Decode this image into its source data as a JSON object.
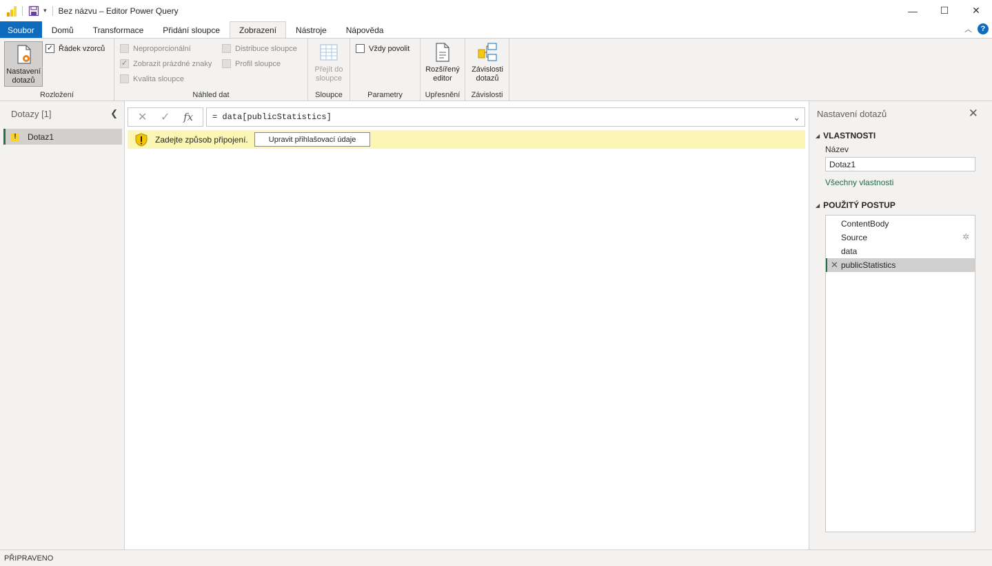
{
  "titlebar": {
    "title": "Bez názvu – Editor Power Query",
    "minimize": "—",
    "maximize": "☐",
    "close": "✕"
  },
  "tabs": [
    {
      "label": "Soubor"
    },
    {
      "label": "Domů"
    },
    {
      "label": "Transformace"
    },
    {
      "label": "Přidání sloupce"
    },
    {
      "label": "Zobrazení"
    },
    {
      "label": "Nástroje"
    },
    {
      "label": "Nápověda"
    }
  ],
  "ribbon": {
    "layout": {
      "query_settings": "Nastavení dotazů",
      "formula_bar": "Řádek vzorců",
      "group_label": "Rozložení"
    },
    "preview": {
      "monospaced": "Neproporcionální",
      "show_whitespace": "Zobrazit prázdné znaky",
      "column_quality": "Kvalita sloupce",
      "column_distribution": "Distribuce sloupce",
      "column_profile": "Profil sloupce",
      "group_label": "Náhled dat"
    },
    "columns": {
      "goto_column": "Přejít do sloupce",
      "group_label": "Sloupce"
    },
    "parameters": {
      "always_allow": "Vždy povolit",
      "group_label": "Parametry"
    },
    "advanced": {
      "advanced_editor": "Rozšířený editor",
      "group_label": "Upřesnění"
    },
    "dependencies": {
      "query_dependencies": "Závislosti dotazů",
      "group_label": "Závislosti"
    }
  },
  "queries_pane": {
    "title": "Dotazy [1]",
    "items": [
      {
        "label": "Dotaz1",
        "warning": "!"
      }
    ]
  },
  "formula": {
    "cancel": "✕",
    "commit": "✓",
    "fx": "fx",
    "value": "= data[publicStatistics]"
  },
  "warning": {
    "message": "Zadejte způsob připojení.",
    "button": "Upravit přihlašovací údaje"
  },
  "settings_pane": {
    "title": "Nastavení dotazů",
    "properties_header": "VLASTNOSTI",
    "name_label": "Název",
    "name_value": "Dotaz1",
    "all_properties": "Všechny vlastnosti",
    "steps_header": "POUŽITÝ POSTUP",
    "steps": [
      {
        "label": "ContentBody"
      },
      {
        "label": "Source"
      },
      {
        "label": "data"
      },
      {
        "label": "publicStatistics"
      }
    ]
  },
  "status": {
    "text": "PŘIPRAVENO"
  }
}
